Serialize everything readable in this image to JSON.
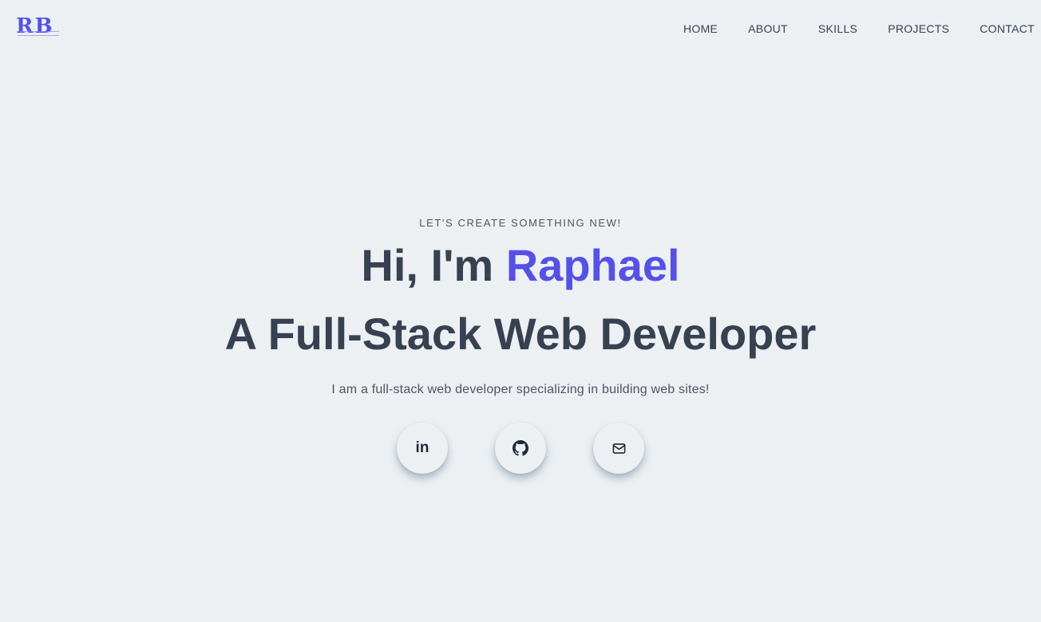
{
  "header": {
    "logo_text": "RB",
    "nav": [
      {
        "label": "HOME"
      },
      {
        "label": "ABOUT"
      },
      {
        "label": "SKILLS"
      },
      {
        "label": "PROJECTS"
      },
      {
        "label": "CONTACT"
      }
    ]
  },
  "hero": {
    "tagline": "LET'S CREATE SOMETHING NEW!",
    "greeting_prefix": "Hi, I'm ",
    "name": "Raphael",
    "headline": "A Full-Stack Web Developer",
    "intro": "I am a full-stack web developer specializing in building web sites!"
  },
  "social": {
    "linkedin_icon_text": "in",
    "items": [
      {
        "icon": "linkedin-icon"
      },
      {
        "icon": "github-icon"
      },
      {
        "icon": "mail-icon"
      }
    ]
  },
  "colors": {
    "background": "#ecf0f3",
    "accent": "#5651e5",
    "text": "#374151"
  }
}
